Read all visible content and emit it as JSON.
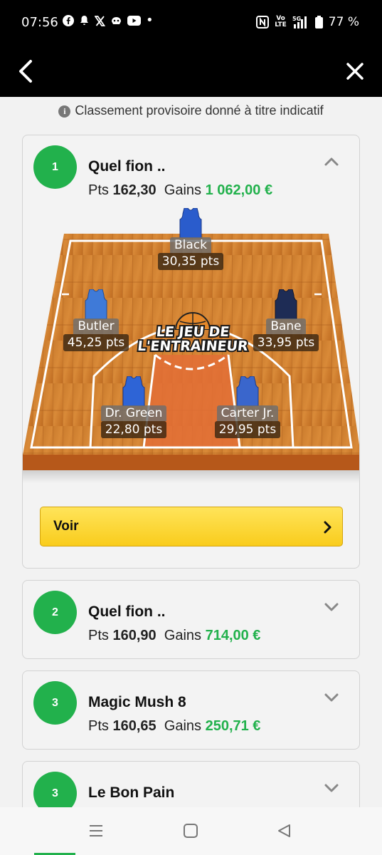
{
  "status": {
    "time": "07:56",
    "net": "Vo\nLTE",
    "network": "5G",
    "battery": "77 %"
  },
  "notice": "Classement provisoire donné à titre indicatif",
  "labels": {
    "pts": "Pts",
    "gains": "Gains"
  },
  "entries": [
    {
      "rank": "1",
      "name": "Quel fion ..",
      "pts": "162,30",
      "gains": "1 062,00 €",
      "expanded": true
    },
    {
      "rank": "2",
      "name": "Quel fion ..",
      "pts": "160,90",
      "gains": "714,00 €"
    },
    {
      "rank": "3",
      "name": "Magic Mush 8",
      "pts": "160,65",
      "gains": "250,71 €"
    },
    {
      "rank": "3",
      "name": "Le Bon Pain"
    }
  ],
  "court": {
    "logo_line1": "LE JEU DE",
    "logo_line2": "L'ENTRAINEUR",
    "players": [
      {
        "name": "Black",
        "pts": "30,35 pts",
        "jersey": "#2a5ccc"
      },
      {
        "name": "Butler",
        "pts": "45,25 pts",
        "jersey": "#3f7ad8"
      },
      {
        "name": "Bane",
        "pts": "33,95 pts",
        "jersey": "#1e2c55"
      },
      {
        "name": "Dr. Green",
        "pts": "22,80 pts",
        "jersey": "#2e64d6"
      },
      {
        "name": "Carter Jr.",
        "pts": "29,95 pts",
        "jersey": "#3a66cc"
      }
    ]
  },
  "voir_label": "Voir",
  "colors": {
    "accent": "#22b14c",
    "button": "#fdd835"
  }
}
